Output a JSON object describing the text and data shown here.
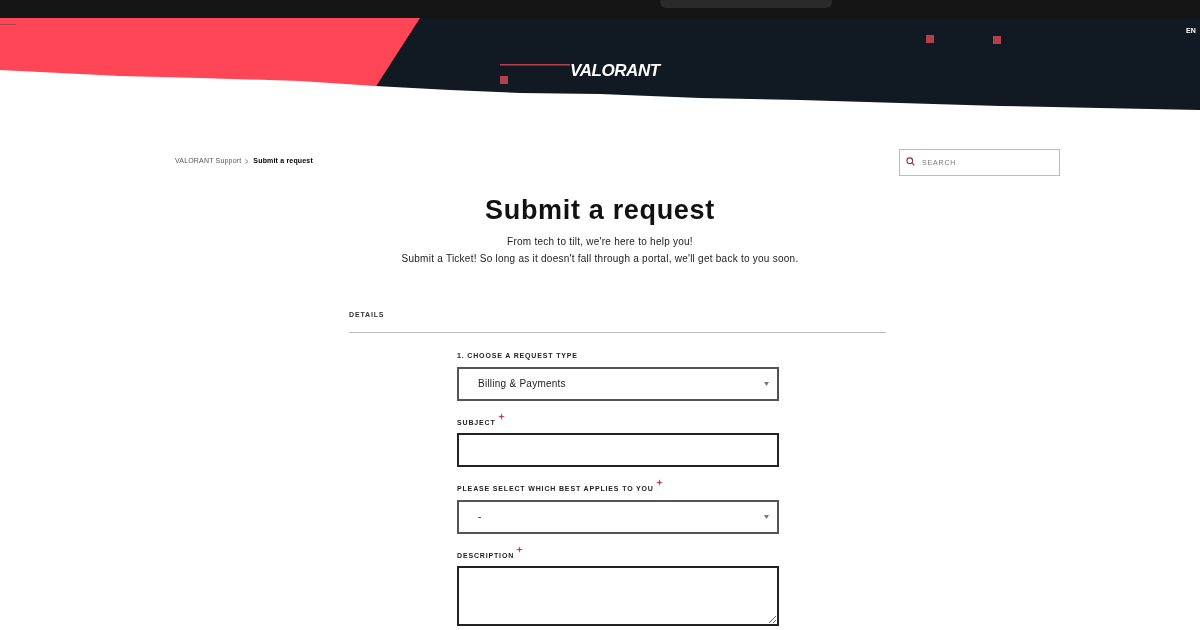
{
  "header": {
    "logo": "VALORANT",
    "language": "EN"
  },
  "breadcrumb": [
    {
      "label": "VALORANT Support",
      "current": false
    },
    {
      "label": "Submit a request",
      "current": true
    }
  ],
  "search": {
    "placeholder": "SEARCH"
  },
  "title": "Submit a request",
  "subtitle": [
    "From tech to tilt, we're here to help you!",
    "Submit a Ticket! So long as it doesn't fall through a portal, we'll get back to you soon."
  ],
  "section": "DETAILS",
  "fields": [
    {
      "kind": "select",
      "label": "1. CHOOSE A REQUEST TYPE",
      "required": false,
      "value": "Billing & Payments"
    },
    {
      "kind": "text",
      "label": "SUBJECT",
      "required": true
    },
    {
      "kind": "select",
      "label": "PLEASE SELECT WHICH BEST APPLIES TO YOU",
      "required": true,
      "value": "-"
    },
    {
      "kind": "textarea",
      "label": "DESCRIPTION",
      "required": true
    }
  ]
}
